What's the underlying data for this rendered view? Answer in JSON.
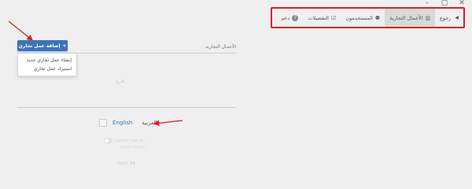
{
  "window_controls": [
    "–",
    "▢",
    "✕"
  ],
  "nav": {
    "back_label": "رجوع",
    "items": [
      {
        "label": "الأعمال التجارية",
        "icon": "building-icon",
        "glyph": "▥",
        "active": true
      },
      {
        "label": "المستخدمون",
        "icon": "users-icon",
        "glyph": "⚉",
        "active": false
      },
      {
        "label": "التفضيلات",
        "icon": "preferences-icon",
        "glyph": "☑",
        "active": false
      },
      {
        "label": "دعم",
        "icon": "help-icon",
        "glyph": "?",
        "active": false
      }
    ]
  },
  "add_button": {
    "label": "إضافة عمل تجاري",
    "icon": "plus-icon",
    "glyph": "+"
  },
  "dropdown": {
    "items": [
      "إنشاء عمل تجاري جديد",
      "استيراد عمل تجاري"
    ]
  },
  "section_title": "الأعمال التجارية",
  "empty_text": "فارغ",
  "language": {
    "english": "English",
    "arabic": "العربية"
  },
  "footer": {
    "toggle_text": "Learn how to...",
    "sub_text": "Learn more...",
    "version": "2017.14"
  },
  "colors": {
    "annotation_red": "#e01b24",
    "primary_blue": "#3b74b6"
  }
}
